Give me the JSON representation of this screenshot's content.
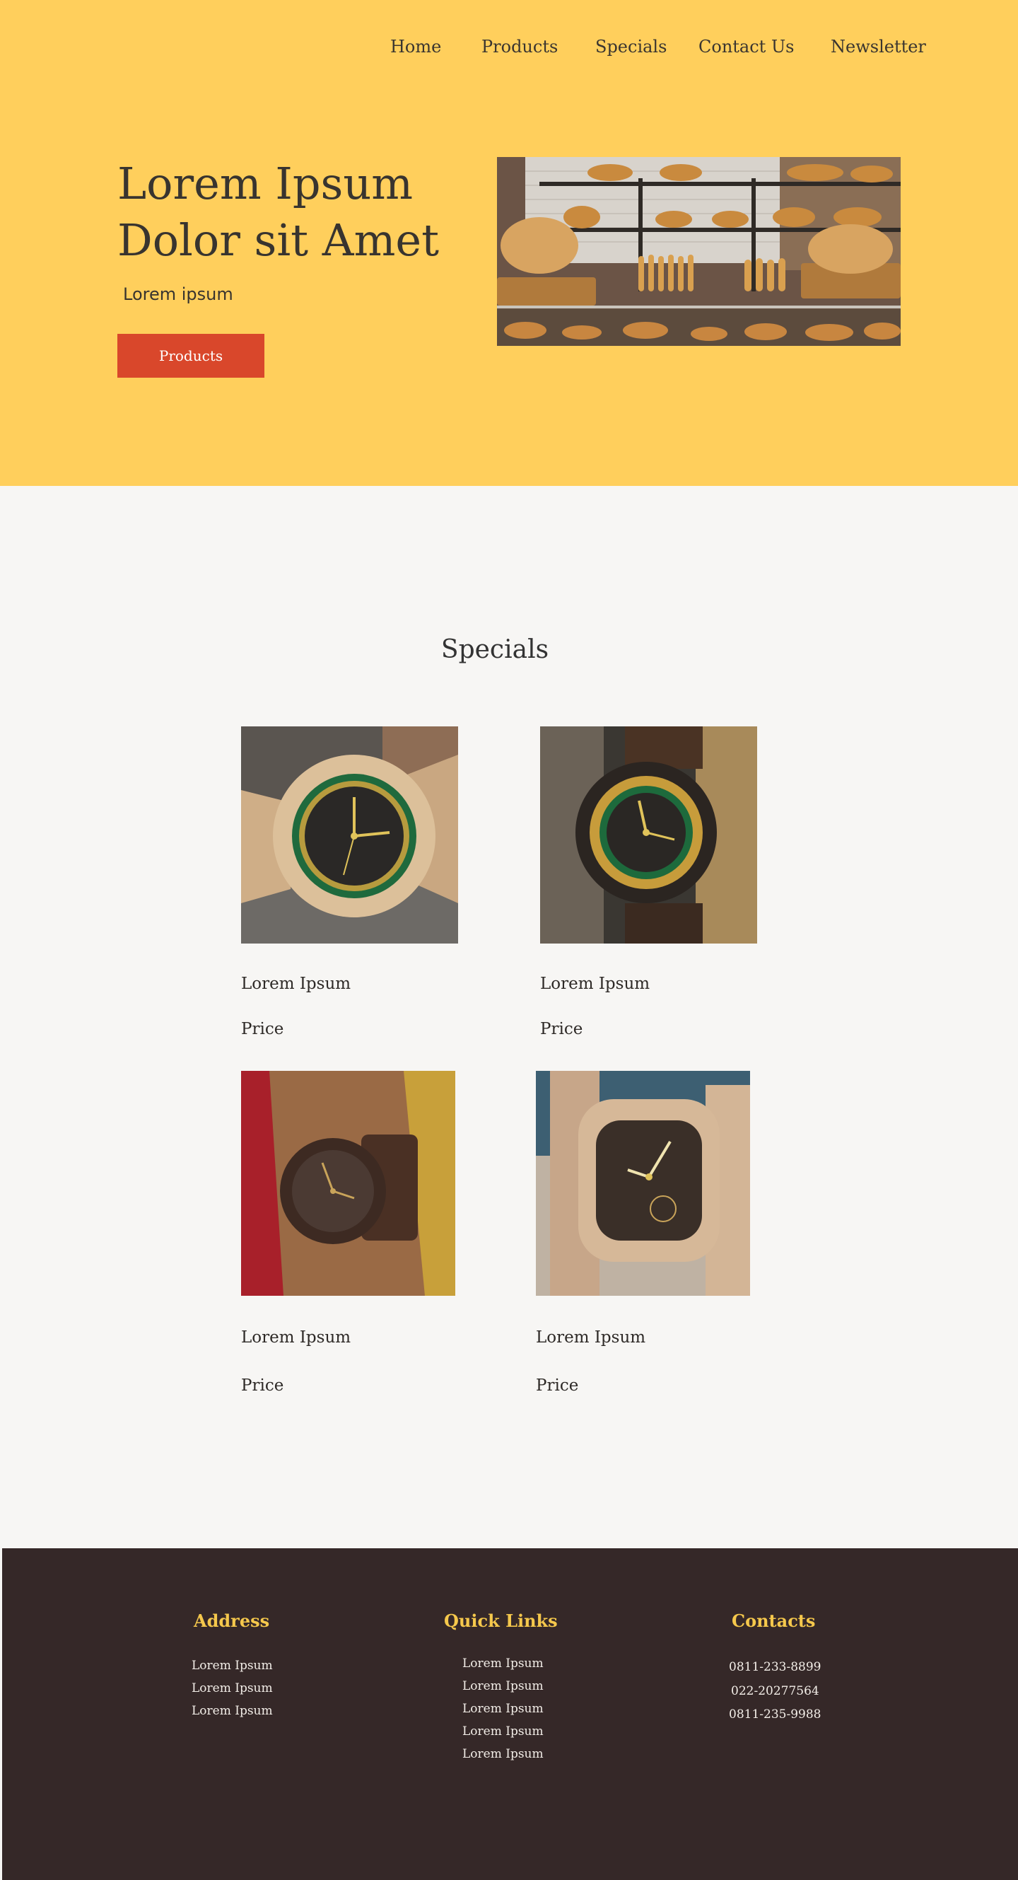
{
  "nav": {
    "items": [
      {
        "label": "Home"
      },
      {
        "label": "Products"
      },
      {
        "label": "Specials"
      },
      {
        "label": "Contact Us"
      },
      {
        "label": "Newsletter"
      }
    ]
  },
  "hero": {
    "title": "Lorem Ipsum Dolor sit Amet",
    "subtitle": "Lorem ipsum",
    "button_label": "Products",
    "image_icon": "bakery-shelves-photo"
  },
  "specials": {
    "title": "Specials",
    "products": [
      {
        "name": "Lorem Ipsum",
        "price": "Price",
        "image": "light-wood-watch-green-dial"
      },
      {
        "name": "Lorem Ipsum",
        "price": "Price",
        "image": "dark-wood-watch-gold-bezel"
      },
      {
        "name": "Lorem Ipsum",
        "price": "Price",
        "image": "dark-wood-watch-on-wrist"
      },
      {
        "name": "Lorem Ipsum",
        "price": "Price",
        "image": "light-wood-square-watch"
      }
    ]
  },
  "footer": {
    "address": {
      "heading": "Address",
      "lines": [
        "Lorem Ipsum",
        "Lorem Ipsum",
        "Lorem Ipsum"
      ]
    },
    "quick_links": {
      "heading": "Quick Links",
      "links": [
        "Lorem Ipsum",
        "Lorem Ipsum",
        "Lorem Ipsum",
        "Lorem Ipsum",
        "Lorem Ipsum"
      ]
    },
    "contacts": {
      "heading": "Contacts",
      "phones": [
        "0811-233-8899",
        "022-20277564",
        "0811-235-9988"
      ]
    }
  },
  "colors": {
    "hero_bg": "#ffcf5c",
    "accent_button": "#d9472b",
    "page_bg": "#f7f6f4",
    "footer_bg": "#352828",
    "footer_heading": "#f5c84c"
  }
}
